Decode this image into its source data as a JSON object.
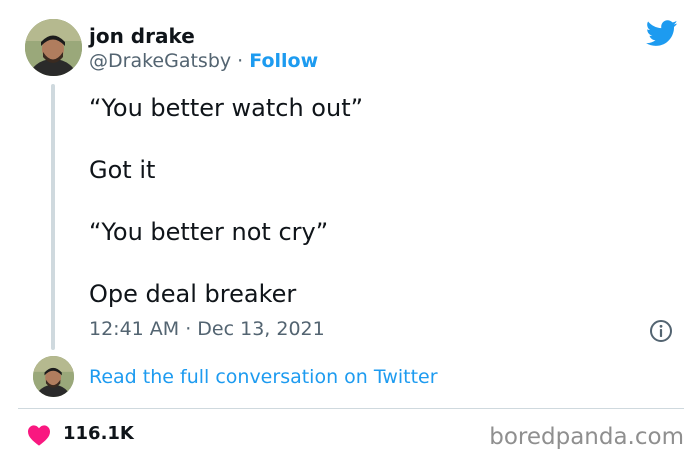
{
  "author": {
    "display_name": "jon drake",
    "handle": "@DrakeGatsby",
    "separator": " · ",
    "follow_label": "Follow"
  },
  "tweet": {
    "lines": [
      "“You better watch out”",
      "Got it",
      "“You better not cry”",
      "Ope deal breaker"
    ],
    "timestamp": "12:41 AM · Dec 13, 2021"
  },
  "conversation": {
    "link_label": "Read the full conversation on Twitter"
  },
  "engagement": {
    "likes": "116.1K"
  },
  "watermark": {
    "text": "boredpanda.com"
  },
  "colors": {
    "accent": "#1d9bf0",
    "like": "#f91880",
    "secondary_text": "#536471",
    "divider": "#cfd9de"
  },
  "icons": {
    "logo": "twitter-bird-icon",
    "info": "info-icon",
    "like": "heart-icon"
  }
}
